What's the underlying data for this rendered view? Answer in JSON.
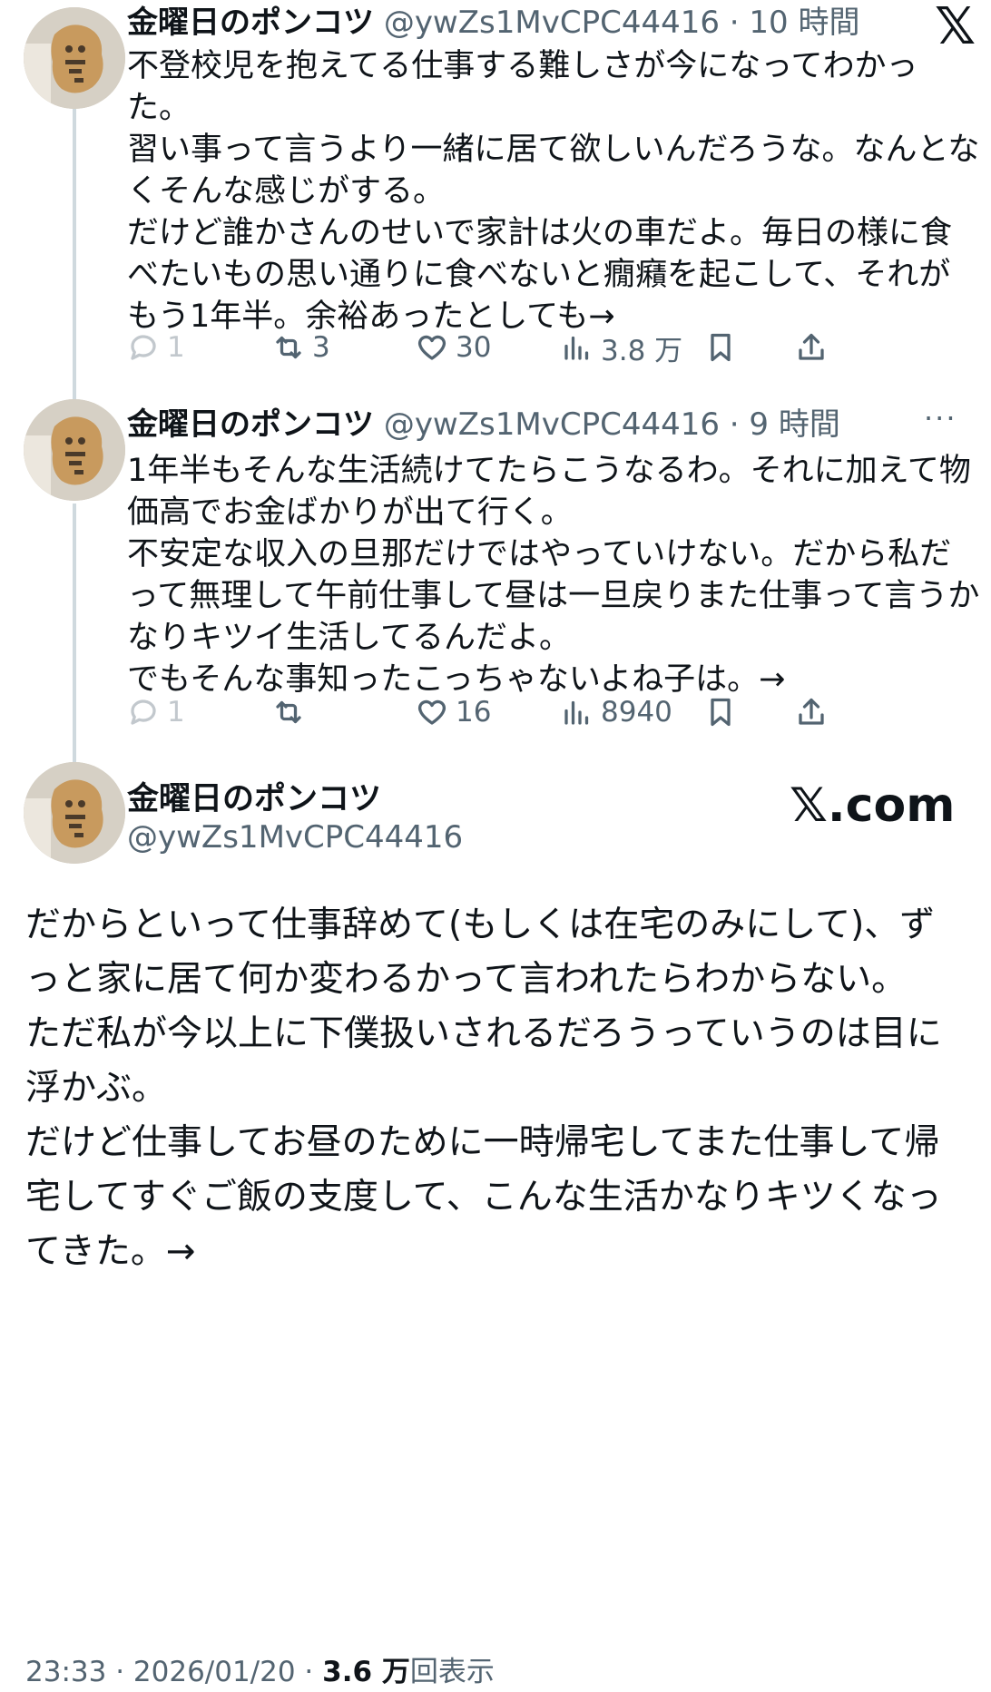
{
  "top_right_logo": "𝕏",
  "thread": [
    {
      "author_name": "金曜日のポンコツ",
      "handle": "@ywZs1MvCPC44416",
      "time": "· 10 時間",
      "text": "不登校児を抱えてる仕事する難しさが今になってわかった。\n習い事って言うより一緒に居て欲しいんだろうな。なんとなくそんな感じがする。\nだけど誰かさんのせいで家計は火の車だよ。毎日の様に食べたいもの思い通りに食べないと癇癪を起こして、それがもう1年半。余裕あったとしても→",
      "stats": {
        "replies": "1",
        "reposts": "3",
        "likes": "30",
        "views": "3.8 万"
      }
    },
    {
      "author_name": "金曜日のポンコツ",
      "handle": "@ywZs1MvCPC44416",
      "time": "· 9 時間",
      "text": "1年半もそんな生活続けてたらこうなるわ。それに加えて物価高でお金ばかりが出て行く。\n不安定な収入の旦那だけではやっていけない。だから私だって無理して午前仕事して昼は一旦戻りまた仕事って言うかなりキツイ生活してるんだよ。\nでもそんな事知ったこっちゃないよね子は。→",
      "stats": {
        "replies": "1",
        "reposts": "",
        "likes": "16",
        "views": "8940"
      }
    }
  ],
  "more_label": "···",
  "main_post": {
    "author_name": "金曜日のポンコツ",
    "handle": "@ywZs1MvCPC44416",
    "watermark": "𝕏.com",
    "text": "だからといって仕事辞めて(もしくは在宅のみにして)、ずっと家に居て何か変わるかって言われたらわからない。\nただ私が今以上に下僕扱いされるだろうっていうのは目に浮かぶ。\nだけど仕事してお昼のために一時帰宅してまた仕事して帰宅してすぐご飯の支度して、こんな生活かなりキツくなってきた。→",
    "timestamp": "23:33 · 2026/01/20 · ",
    "view_count": "3.6 万",
    "view_label": "回表示"
  }
}
